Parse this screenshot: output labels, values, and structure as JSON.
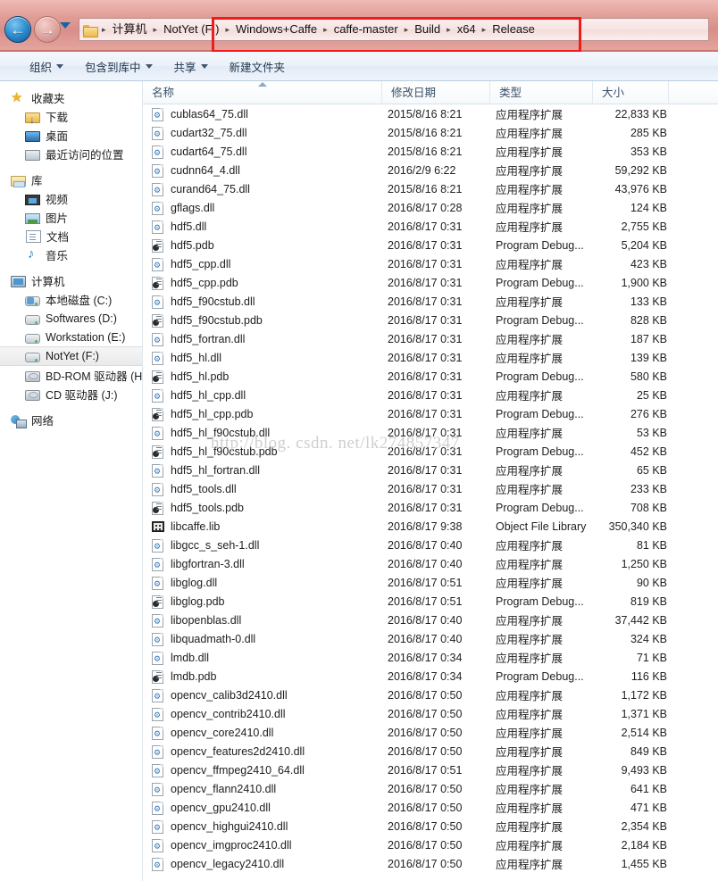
{
  "window": {
    "nav": {
      "back_label": "←",
      "forward_label": "→",
      "recent_pages_label": "▾"
    },
    "address": {
      "folder_icon": "folder-icon",
      "crumbs": [
        "计算机",
        "NotYet (F:)",
        "Windows+Caffe",
        "caffe-master",
        "Build",
        "x64",
        "Release"
      ],
      "separator": "▸"
    },
    "annotation": {
      "highlight_color": "#ee1c1c"
    }
  },
  "commandbar": {
    "items": [
      {
        "label": "组织",
        "has_caret": true
      },
      {
        "label": "包含到库中",
        "has_caret": true
      },
      {
        "label": "共享",
        "has_caret": true
      },
      {
        "label": "新建文件夹",
        "has_caret": false
      }
    ]
  },
  "sidebar": {
    "groups": [
      {
        "head": {
          "label": "收藏夹",
          "icon": "star-icon"
        },
        "items": [
          {
            "label": "下载",
            "icon": "downloads-icon",
            "selected": false
          },
          {
            "label": "桌面",
            "icon": "desktop-icon",
            "selected": false
          },
          {
            "label": "最近访问的位置",
            "icon": "recent-places-icon",
            "selected": false
          }
        ]
      },
      {
        "head": {
          "label": "库",
          "icon": "library-icon"
        },
        "items": [
          {
            "label": "视频",
            "icon": "videos-icon",
            "selected": false
          },
          {
            "label": "图片",
            "icon": "pictures-icon",
            "selected": false
          },
          {
            "label": "文档",
            "icon": "documents-icon",
            "selected": false
          },
          {
            "label": "音乐",
            "icon": "music-icon",
            "selected": false
          }
        ]
      },
      {
        "head": {
          "label": "计算机",
          "icon": "computer-icon"
        },
        "items": [
          {
            "label": "本地磁盘 (C:)",
            "icon": "system-drive-icon",
            "selected": false
          },
          {
            "label": "Softwares (D:)",
            "icon": "drive-icon",
            "selected": false
          },
          {
            "label": "Workstation (E:)",
            "icon": "drive-icon",
            "selected": false
          },
          {
            "label": "NotYet (F:)",
            "icon": "drive-icon",
            "selected": true
          },
          {
            "label": "BD-ROM 驱动器 (H",
            "icon": "optical-drive-icon",
            "selected": false
          },
          {
            "label": "CD 驱动器 (J:)",
            "icon": "optical-drive-icon",
            "selected": false
          }
        ]
      },
      {
        "head": {
          "label": "网络",
          "icon": "network-icon"
        },
        "items": []
      }
    ]
  },
  "filelist": {
    "columns": [
      {
        "key": "name",
        "label": "名称",
        "sorted": true
      },
      {
        "key": "date",
        "label": "修改日期",
        "sorted": false
      },
      {
        "key": "type",
        "label": "类型",
        "sorted": false
      },
      {
        "key": "size",
        "label": "大小",
        "sorted": false
      }
    ],
    "type_labels": {
      "dll": "应用程序扩展",
      "pdb": "Program Debug...",
      "lib": "Object File Library"
    },
    "rows": [
      {
        "icon": "dll",
        "name": "cublas64_75.dll",
        "date": "2015/8/16 8:21",
        "type": "应用程序扩展",
        "size": "22,833 KB"
      },
      {
        "icon": "dll",
        "name": "cudart32_75.dll",
        "date": "2015/8/16 8:21",
        "type": "应用程序扩展",
        "size": "285 KB"
      },
      {
        "icon": "dll",
        "name": "cudart64_75.dll",
        "date": "2015/8/16 8:21",
        "type": "应用程序扩展",
        "size": "353 KB"
      },
      {
        "icon": "dll",
        "name": "cudnn64_4.dll",
        "date": "2016/2/9 6:22",
        "type": "应用程序扩展",
        "size": "59,292 KB"
      },
      {
        "icon": "dll",
        "name": "curand64_75.dll",
        "date": "2015/8/16 8:21",
        "type": "应用程序扩展",
        "size": "43,976 KB"
      },
      {
        "icon": "dll",
        "name": "gflags.dll",
        "date": "2016/8/17 0:28",
        "type": "应用程序扩展",
        "size": "124 KB"
      },
      {
        "icon": "dll",
        "name": "hdf5.dll",
        "date": "2016/8/17 0:31",
        "type": "应用程序扩展",
        "size": "2,755 KB"
      },
      {
        "icon": "pdb",
        "name": "hdf5.pdb",
        "date": "2016/8/17 0:31",
        "type": "Program Debug...",
        "size": "5,204 KB"
      },
      {
        "icon": "dll",
        "name": "hdf5_cpp.dll",
        "date": "2016/8/17 0:31",
        "type": "应用程序扩展",
        "size": "423 KB"
      },
      {
        "icon": "pdb",
        "name": "hdf5_cpp.pdb",
        "date": "2016/8/17 0:31",
        "type": "Program Debug...",
        "size": "1,900 KB"
      },
      {
        "icon": "dll",
        "name": "hdf5_f90cstub.dll",
        "date": "2016/8/17 0:31",
        "type": "应用程序扩展",
        "size": "133 KB"
      },
      {
        "icon": "pdb",
        "name": "hdf5_f90cstub.pdb",
        "date": "2016/8/17 0:31",
        "type": "Program Debug...",
        "size": "828 KB"
      },
      {
        "icon": "dll",
        "name": "hdf5_fortran.dll",
        "date": "2016/8/17 0:31",
        "type": "应用程序扩展",
        "size": "187 KB"
      },
      {
        "icon": "dll",
        "name": "hdf5_hl.dll",
        "date": "2016/8/17 0:31",
        "type": "应用程序扩展",
        "size": "139 KB"
      },
      {
        "icon": "pdb",
        "name": "hdf5_hl.pdb",
        "date": "2016/8/17 0:31",
        "type": "Program Debug...",
        "size": "580 KB"
      },
      {
        "icon": "dll",
        "name": "hdf5_hl_cpp.dll",
        "date": "2016/8/17 0:31",
        "type": "应用程序扩展",
        "size": "25 KB"
      },
      {
        "icon": "pdb",
        "name": "hdf5_hl_cpp.pdb",
        "date": "2016/8/17 0:31",
        "type": "Program Debug...",
        "size": "276 KB"
      },
      {
        "icon": "dll",
        "name": "hdf5_hl_f90cstub.dll",
        "date": "2016/8/17 0:31",
        "type": "应用程序扩展",
        "size": "53 KB"
      },
      {
        "icon": "pdb",
        "name": "hdf5_hl_f90cstub.pdb",
        "date": "2016/8/17 0:31",
        "type": "Program Debug...",
        "size": "452 KB"
      },
      {
        "icon": "dll",
        "name": "hdf5_hl_fortran.dll",
        "date": "2016/8/17 0:31",
        "type": "应用程序扩展",
        "size": "65 KB"
      },
      {
        "icon": "dll",
        "name": "hdf5_tools.dll",
        "date": "2016/8/17 0:31",
        "type": "应用程序扩展",
        "size": "233 KB"
      },
      {
        "icon": "pdb",
        "name": "hdf5_tools.pdb",
        "date": "2016/8/17 0:31",
        "type": "Program Debug...",
        "size": "708 KB"
      },
      {
        "icon": "lib",
        "name": "libcaffe.lib",
        "date": "2016/8/17 9:38",
        "type": "Object File Library",
        "size": "350,340 KB"
      },
      {
        "icon": "dll",
        "name": "libgcc_s_seh-1.dll",
        "date": "2016/8/17 0:40",
        "type": "应用程序扩展",
        "size": "81 KB"
      },
      {
        "icon": "dll",
        "name": "libgfortran-3.dll",
        "date": "2016/8/17 0:40",
        "type": "应用程序扩展",
        "size": "1,250 KB"
      },
      {
        "icon": "dll",
        "name": "libglog.dll",
        "date": "2016/8/17 0:51",
        "type": "应用程序扩展",
        "size": "90 KB"
      },
      {
        "icon": "pdb",
        "name": "libglog.pdb",
        "date": "2016/8/17 0:51",
        "type": "Program Debug...",
        "size": "819 KB"
      },
      {
        "icon": "dll",
        "name": "libopenblas.dll",
        "date": "2016/8/17 0:40",
        "type": "应用程序扩展",
        "size": "37,442 KB"
      },
      {
        "icon": "dll",
        "name": "libquadmath-0.dll",
        "date": "2016/8/17 0:40",
        "type": "应用程序扩展",
        "size": "324 KB"
      },
      {
        "icon": "dll",
        "name": "lmdb.dll",
        "date": "2016/8/17 0:34",
        "type": "应用程序扩展",
        "size": "71 KB"
      },
      {
        "icon": "pdb",
        "name": "lmdb.pdb",
        "date": "2016/8/17 0:34",
        "type": "Program Debug...",
        "size": "116 KB"
      },
      {
        "icon": "dll",
        "name": "opencv_calib3d2410.dll",
        "date": "2016/8/17 0:50",
        "type": "应用程序扩展",
        "size": "1,172 KB"
      },
      {
        "icon": "dll",
        "name": "opencv_contrib2410.dll",
        "date": "2016/8/17 0:50",
        "type": "应用程序扩展",
        "size": "1,371 KB"
      },
      {
        "icon": "dll",
        "name": "opencv_core2410.dll",
        "date": "2016/8/17 0:50",
        "type": "应用程序扩展",
        "size": "2,514 KB"
      },
      {
        "icon": "dll",
        "name": "opencv_features2d2410.dll",
        "date": "2016/8/17 0:50",
        "type": "应用程序扩展",
        "size": "849 KB"
      },
      {
        "icon": "dll",
        "name": "opencv_ffmpeg2410_64.dll",
        "date": "2016/8/17 0:51",
        "type": "应用程序扩展",
        "size": "9,493 KB"
      },
      {
        "icon": "dll",
        "name": "opencv_flann2410.dll",
        "date": "2016/8/17 0:50",
        "type": "应用程序扩展",
        "size": "641 KB"
      },
      {
        "icon": "dll",
        "name": "opencv_gpu2410.dll",
        "date": "2016/8/17 0:50",
        "type": "应用程序扩展",
        "size": "471 KB"
      },
      {
        "icon": "dll",
        "name": "opencv_highgui2410.dll",
        "date": "2016/8/17 0:50",
        "type": "应用程序扩展",
        "size": "2,354 KB"
      },
      {
        "icon": "dll",
        "name": "opencv_imgproc2410.dll",
        "date": "2016/8/17 0:50",
        "type": "应用程序扩展",
        "size": "2,184 KB"
      },
      {
        "icon": "dll",
        "name": "opencv_legacy2410.dll",
        "date": "2016/8/17 0:50",
        "type": "应用程序扩展",
        "size": "1,455 KB"
      }
    ]
  },
  "watermark": {
    "text": "http://blog. csdn. net/lk274857347"
  }
}
